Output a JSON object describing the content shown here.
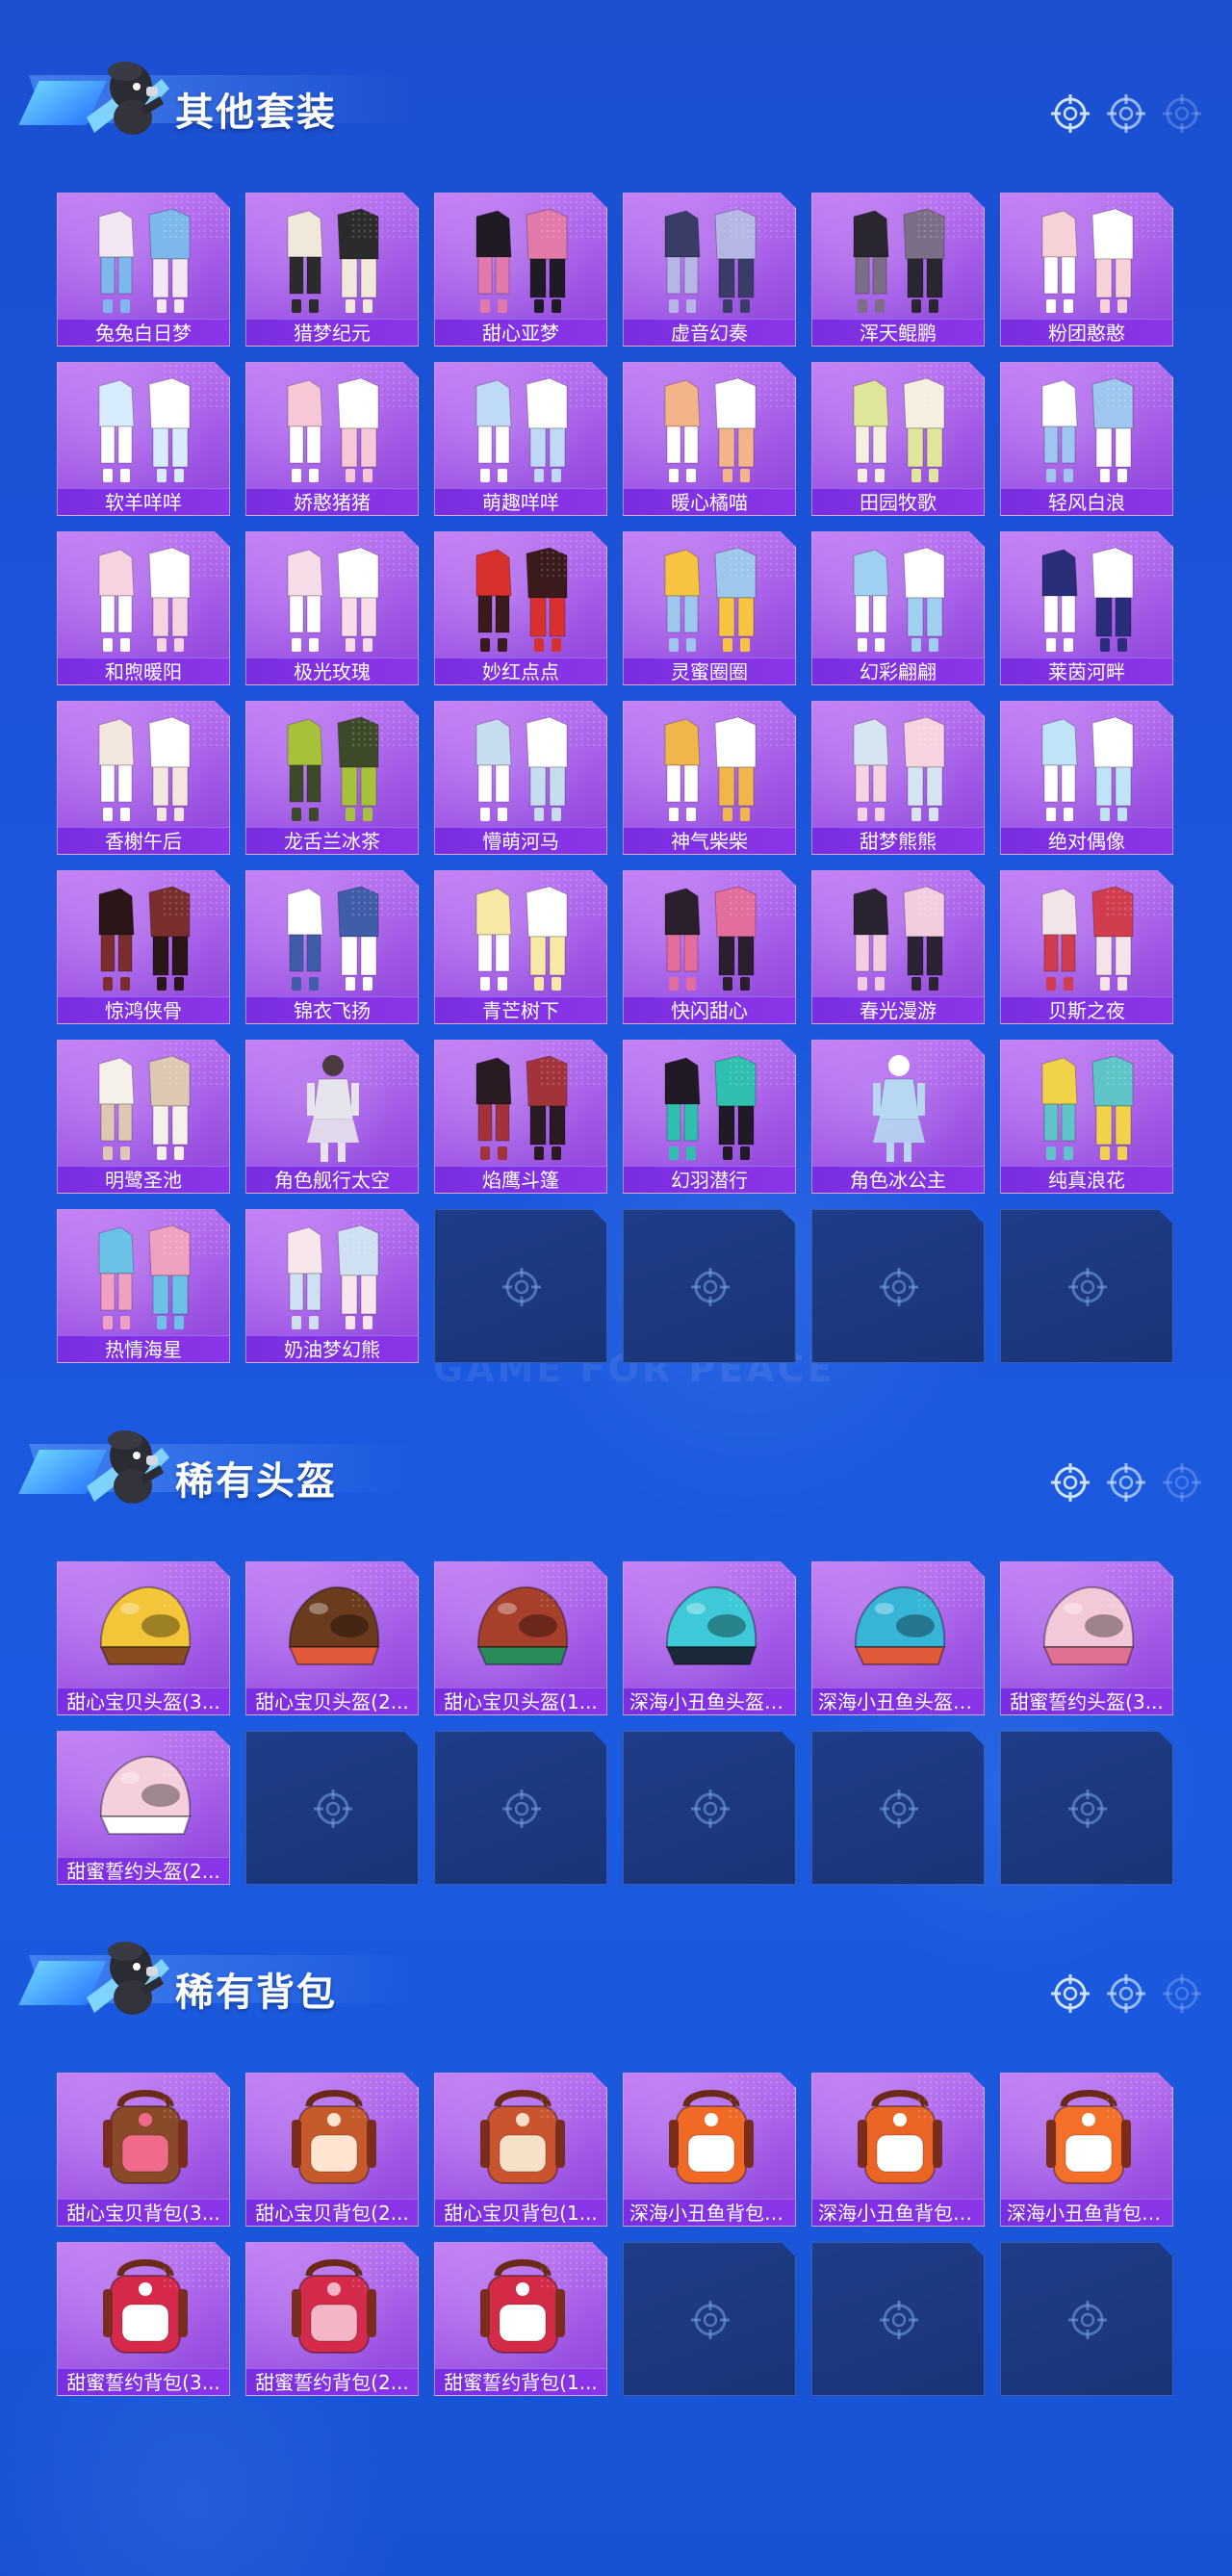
{
  "sections": [
    {
      "title": "其他套装",
      "items": [
        {
          "name": "兔兔白日梦",
          "kind": "outfit",
          "colors": [
            "#f3e7f3",
            "#7db7ec"
          ]
        },
        {
          "name": "猎梦纪元",
          "kind": "outfit",
          "colors": [
            "#f0e9da",
            "#2b2b2b"
          ]
        },
        {
          "name": "甜心亚梦",
          "kind": "outfit",
          "colors": [
            "#1f1b24",
            "#e27aa9"
          ]
        },
        {
          "name": "虚音幻奏",
          "kind": "outfit",
          "colors": [
            "#3a3c68",
            "#b5b6e6"
          ]
        },
        {
          "name": "浑天鲲鹏",
          "kind": "outfit",
          "colors": [
            "#2a2630",
            "#7b6e86"
          ]
        },
        {
          "name": "粉团憨憨",
          "kind": "outfit",
          "colors": [
            "#f6d2d7",
            "#ffffff"
          ]
        },
        {
          "name": "软羊咩咩",
          "kind": "outfit",
          "colors": [
            "#d7ecff",
            "#ffffff"
          ]
        },
        {
          "name": "娇憨猪猪",
          "kind": "outfit",
          "colors": [
            "#f7c7d6",
            "#ffffff"
          ]
        },
        {
          "name": "萌趣咩咩",
          "kind": "outfit",
          "colors": [
            "#bfdaf7",
            "#ffffff"
          ]
        },
        {
          "name": "暖心橘喵",
          "kind": "outfit",
          "colors": [
            "#f4b48a",
            "#ffffff"
          ]
        },
        {
          "name": "田园牧歌",
          "kind": "outfit",
          "colors": [
            "#dfe69a",
            "#f5efe0"
          ]
        },
        {
          "name": "轻风白浪",
          "kind": "outfit",
          "colors": [
            "#ffffff",
            "#9ec6ee"
          ]
        },
        {
          "name": "和煦暖阳",
          "kind": "outfit",
          "colors": [
            "#f6d3e0",
            "#ffffff"
          ]
        },
        {
          "name": "极光玫瑰",
          "kind": "outfit",
          "colors": [
            "#f6dde8",
            "#ffffff"
          ]
        },
        {
          "name": "妙红点点",
          "kind": "outfit",
          "colors": [
            "#d8302d",
            "#3a1a1a"
          ]
        },
        {
          "name": "灵蜜圈圈",
          "kind": "outfit",
          "colors": [
            "#f6c440",
            "#9ec7ee"
          ]
        },
        {
          "name": "幻彩翩翩",
          "kind": "outfit",
          "colors": [
            "#9fd0f2",
            "#ffffff"
          ]
        },
        {
          "name": "莱茵河畔",
          "kind": "outfit",
          "colors": [
            "#2a2d7a",
            "#ffffff"
          ]
        },
        {
          "name": "香榭午后",
          "kind": "outfit",
          "colors": [
            "#f3e6dc",
            "#ffffff"
          ]
        },
        {
          "name": "龙舌兰冰茶",
          "kind": "outfit",
          "colors": [
            "#a6c23a",
            "#3d4a2a"
          ]
        },
        {
          "name": "懵萌河马",
          "kind": "outfit",
          "colors": [
            "#c6dcef",
            "#ffffff"
          ]
        },
        {
          "name": "神气柴柴",
          "kind": "outfit",
          "colors": [
            "#f0b649",
            "#ffffff"
          ]
        },
        {
          "name": "甜梦熊熊",
          "kind": "outfit",
          "colors": [
            "#d7e4f1",
            "#f6d3e0"
          ]
        },
        {
          "name": "绝对偶像",
          "kind": "outfit",
          "colors": [
            "#bfe3f7",
            "#ffffff"
          ]
        },
        {
          "name": "惊鸿侠骨",
          "kind": "outfit",
          "colors": [
            "#2a1517",
            "#7a2d2d"
          ]
        },
        {
          "name": "锦衣飞扬",
          "kind": "outfit",
          "colors": [
            "#ffffff",
            "#3f5da8"
          ]
        },
        {
          "name": "青芒树下",
          "kind": "outfit",
          "colors": [
            "#f6e9a4",
            "#ffffff"
          ]
        },
        {
          "name": "快闪甜心",
          "kind": "outfit",
          "colors": [
            "#2c1f2d",
            "#e36d9d"
          ]
        },
        {
          "name": "春光漫游",
          "kind": "outfit",
          "colors": [
            "#2a2332",
            "#f2cde0"
          ]
        },
        {
          "name": "贝斯之夜",
          "kind": "outfit",
          "colors": [
            "#f3e4e7",
            "#d13d4f"
          ]
        },
        {
          "name": "明鹭圣池",
          "kind": "outfit",
          "colors": [
            "#f6f0ea",
            "#ddc9b3"
          ]
        },
        {
          "name": "角色舰行太空",
          "kind": "figure",
          "colors": [
            "#e8e4ee",
            "#4b3b3f"
          ]
        },
        {
          "name": "焰鹰斗篷",
          "kind": "outfit",
          "colors": [
            "#2a1a22",
            "#a3333b"
          ]
        },
        {
          "name": "幻羽潜行",
          "kind": "outfit",
          "colors": [
            "#1f1a26",
            "#2fbfae"
          ]
        },
        {
          "name": "角色冰公主",
          "kind": "figure",
          "colors": [
            "#b6d8f2",
            "#ffffff"
          ]
        },
        {
          "name": "纯真浪花",
          "kind": "outfit",
          "colors": [
            "#f1d349",
            "#5fc4c7"
          ]
        },
        {
          "name": "热情海星",
          "kind": "outfit",
          "colors": [
            "#6cc2e6",
            "#f0a0c0"
          ]
        },
        {
          "name": "奶油梦幻熊",
          "kind": "outfit",
          "colors": [
            "#f7e6ec",
            "#cfe0f2"
          ]
        }
      ],
      "empty_slots": 4
    },
    {
      "title": "稀有头盔",
      "items": [
        {
          "name": "甜心宝贝头盔(3...",
          "kind": "helmet",
          "colors": [
            "#f3c538",
            "#8a4a22"
          ]
        },
        {
          "name": "甜心宝贝头盔(2...",
          "kind": "helmet",
          "colors": [
            "#6a3b1c",
            "#e25a3a"
          ]
        },
        {
          "name": "甜心宝贝头盔(1...",
          "kind": "helmet",
          "colors": [
            "#a6402a",
            "#2b8a5a"
          ]
        },
        {
          "name": "深海小丑鱼头盔(...",
          "kind": "helmet",
          "colors": [
            "#3ec9d9",
            "#1b2a3a"
          ]
        },
        {
          "name": "深海小丑鱼头盔(...",
          "kind": "helmet",
          "colors": [
            "#37b5d9",
            "#e15a3a"
          ]
        },
        {
          "name": "甜蜜誓约头盔(3...",
          "kind": "helmet",
          "colors": [
            "#f3c8d8",
            "#e07090"
          ]
        },
        {
          "name": "甜蜜誓约头盔(2...",
          "kind": "helmet",
          "colors": [
            "#f5cfdc",
            "#ffffff"
          ]
        }
      ],
      "empty_slots": 5
    },
    {
      "title": "稀有背包",
      "items": [
        {
          "name": "甜心宝贝背包(3...",
          "kind": "backpack",
          "colors": [
            "#8a4a2a",
            "#f06a8a"
          ]
        },
        {
          "name": "甜心宝贝背包(2...",
          "kind": "backpack",
          "colors": [
            "#c65a2a",
            "#ffe4d0"
          ]
        },
        {
          "name": "甜心宝贝背包(1...",
          "kind": "backpack",
          "colors": [
            "#c9542e",
            "#f6e0c8"
          ]
        },
        {
          "name": "深海小丑鱼背包(...",
          "kind": "backpack",
          "colors": [
            "#f06a26",
            "#ffffff"
          ]
        },
        {
          "name": "深海小丑鱼背包(...",
          "kind": "backpack",
          "colors": [
            "#ea6424",
            "#ffffff"
          ]
        },
        {
          "name": "深海小丑鱼背包(...",
          "kind": "backpack",
          "colors": [
            "#f47029",
            "#ffffff"
          ]
        },
        {
          "name": "甜蜜誓约背包(3...",
          "kind": "backpack",
          "colors": [
            "#d6284a",
            "#ffffff"
          ]
        },
        {
          "name": "甜蜜誓约背包(2...",
          "kind": "backpack",
          "colors": [
            "#d42a4c",
            "#f4b6c6"
          ]
        },
        {
          "name": "甜蜜誓约背包(1...",
          "kind": "backpack",
          "colors": [
            "#d32a48",
            "#ffffff"
          ]
        }
      ],
      "empty_slots": 3
    }
  ],
  "watermark": "GAME FOR PEACE",
  "theme": {
    "background": "#1b56dc",
    "card_purple": "#a55ce8",
    "label_purple": "#7a2ee0",
    "empty_slot": "#1e3d88"
  }
}
